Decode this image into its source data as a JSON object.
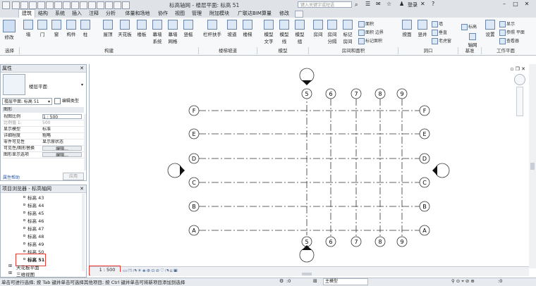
{
  "titlebar": {
    "title": "标高轴网 - 楼层平面: 标高 51",
    "search_placeholder": "键入关键字或短语",
    "login": "登录",
    "minimize": "–",
    "maximize": "□",
    "close": "✕"
  },
  "menu": {
    "tabs": [
      "建筑",
      "结构",
      "系统",
      "插入",
      "注释",
      "分析",
      "体量和场地",
      "协作",
      "视图",
      "管理",
      "附加模块",
      "广联达BIM算量",
      "修改"
    ],
    "active": "建筑"
  },
  "ribbon": {
    "modify": "修改",
    "buttons": [
      "墙",
      "门",
      "窗",
      "构件",
      "柱",
      "屋顶",
      "天花板",
      "楼板",
      "幕墙系统",
      "幕墙网格",
      "竖梃",
      "栏杆扶手",
      "坡道",
      "楼梯",
      "模型文字",
      "模型线",
      "模型组",
      "房间",
      "房间分隔",
      "标记房间",
      "按面",
      "竖井",
      "轴网",
      "设置"
    ],
    "small": [
      "面积",
      "面积 边界",
      "标记面积",
      "墙",
      "垂直",
      "老虎窗",
      "标高",
      "显示",
      "参照 平面",
      "查看器"
    ],
    "groups": [
      "选择",
      "构建",
      "楼梯坡道",
      "模型",
      "房间和面积",
      "洞口",
      "基准",
      "工作平面"
    ]
  },
  "properties": {
    "title": "属性",
    "type_name": "楼层平面",
    "selector": "楼层平面: 标高 51",
    "edit_type": "编辑类型",
    "section": "图形",
    "rows": [
      {
        "k": "视图比例",
        "v": "1 : 500",
        "dim": false
      },
      {
        "k": "比例值 1:",
        "v": "500",
        "dim": true
      },
      {
        "k": "显示模型",
        "v": "标准",
        "dim": false
      },
      {
        "k": "详细程度",
        "v": "粗略",
        "dim": false
      },
      {
        "k": "零件可见性",
        "v": "显示原状态",
        "dim": false
      },
      {
        "k": "可见性/图形替换",
        "v": "编辑...",
        "dim": false
      },
      {
        "k": "图形显示选项",
        "v": "编辑...",
        "dim": false
      }
    ],
    "help": "属性帮助",
    "apply": "应用"
  },
  "browser": {
    "title": "项目浏览器 - 标高轴网",
    "items": [
      "标高 43",
      "标高 44",
      "标高 45",
      "标高 46",
      "标高 47",
      "标高 48",
      "标高 49",
      "标高 50",
      "标高 51"
    ],
    "selected": "标高 51",
    "more": [
      "天花板平面",
      "三维视图"
    ]
  },
  "drawing": {
    "vertical_grids": [
      "5",
      "6",
      "7",
      "8",
      "9"
    ],
    "horizontal_grids": [
      "F",
      "E",
      "D",
      "C",
      "B",
      "A"
    ]
  },
  "viewbar": {
    "scale": "1 : 500"
  },
  "status": {
    "hint": "单击可进行选择; 按 Tab 键并单击可选择其他项目; 按 Ctrl 键并单击可将新项目添加到选择",
    "count": ":0",
    "model": "主模型"
  },
  "colors": {
    "highlight": "#e53935",
    "accent": "#3a6ea5"
  }
}
